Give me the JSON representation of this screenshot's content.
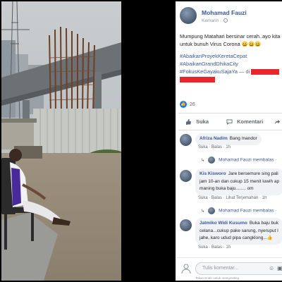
{
  "post": {
    "author": "Mohamad Fauzi",
    "time": "Kemarin",
    "text_line1": "Mumpung Matahari bersinar cerah..ayo kita",
    "text_line2": "untuk bunuh Virus Corona",
    "emoji_line2": "😀😀😀",
    "hashtags": [
      "#AbaikanProyekKeretaCepat",
      "#AbaikanGrandDhikaCity",
      "#FokusKeGayakuSajaYa"
    ],
    "at_label": "— di",
    "reaction_count": "26"
  },
  "actions": {
    "like": "Suka",
    "comment": "Komentari",
    "share_icon": "share-icon"
  },
  "comments": [
    {
      "name": "Afriza Nadim",
      "text": "Bang mandor",
      "meta": "Suka · Balas · 1h",
      "reply_label": "Mohamad Fauzi membalas ·",
      "reply_avatar": "avatar"
    },
    {
      "name": "Kis Kisworo",
      "lines": [
        "Jare bersemure sing pali",
        "jam 10-an dan cukup 15 menit luwih ap",
        "maning buka baju........ om"
      ],
      "meta": "Suka · Balas · Lihat Terjemahan · 1h",
      "reply_label": "Mohamad Fauzi membalas ·",
      "reply_avatar": "avatar"
    },
    {
      "name": "Jatmiko Widi Kusumo",
      "lines": [
        "Buka baju buk",
        "celana...cukup pake sarung, nyeruput l",
        "jahe, karo udud pipa cangklong..."
      ],
      "emoji": "👍",
      "meta": "Suka · Balas · 1h"
    }
  ],
  "composer": {
    "placeholder": "Tulis komentar...",
    "hint": "Tekan Enter untuk memposting."
  }
}
